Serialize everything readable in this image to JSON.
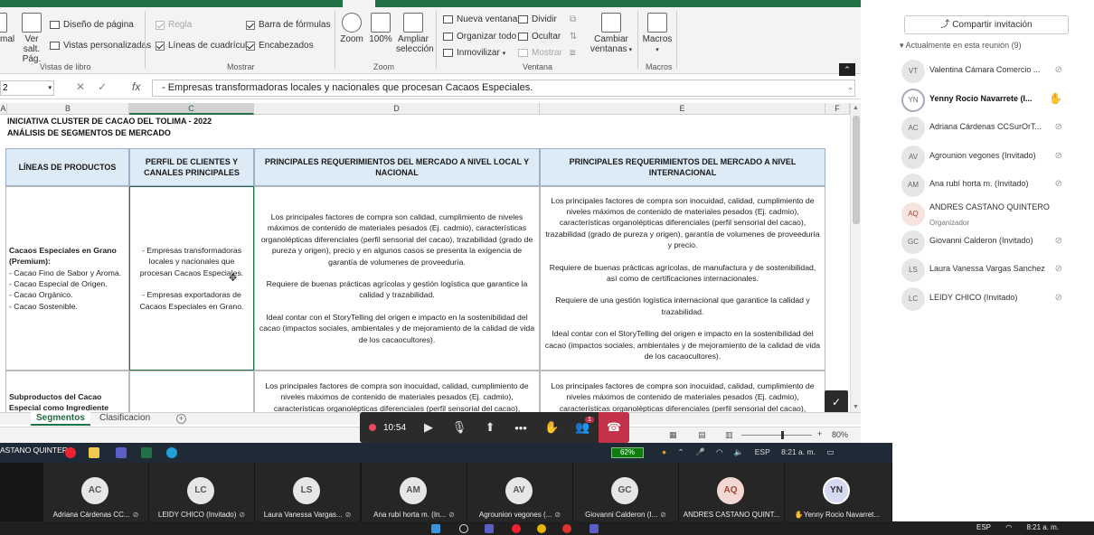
{
  "excel": {
    "ribbon": {
      "ver_salt_line1": "Ver salt.",
      "ver_salt_line2": "Pág.",
      "normal_partial": "mal",
      "diseno_pagina": "Diseño de página",
      "vistas_personalizadas": "Vistas personalizadas",
      "group_vistas": "Vistas de libro",
      "regla": "Regla",
      "barra_formulas": "Barra de fórmulas",
      "lineas_cuadricula": "Líneas de cuadrícula",
      "encabezados": "Encabezados",
      "group_mostrar": "Mostrar",
      "zoom": "Zoom",
      "zoom_100": "100%",
      "ampliar_line1": "Ampliar",
      "ampliar_line2": "selección",
      "group_zoom": "Zoom",
      "nueva_ventana": "Nueva ventana",
      "organizar_todo": "Organizar todo",
      "inmovilizar": "Inmovilizar",
      "dividir": "Dividir",
      "ocultar": "Ocultar",
      "mostrar": "Mostrar",
      "cambiar_line1": "Cambiar",
      "cambiar_line2": "ventanas",
      "group_ventana": "Ventana",
      "macros": "Macros",
      "group_macros": "Macros"
    },
    "formula_bar": {
      "content": "- Empresas transformadoras locales y nacionales que procesan Cacaos Especiales."
    },
    "columns": {
      "a": "A",
      "b": "B",
      "c": "C",
      "d": "D",
      "e": "E",
      "f": "F"
    },
    "sheet": {
      "title1": "INICIATIVA CLUSTER DE CACAO DEL TOLIMA - 2022",
      "title2": "ANÁLISIS DE SEGMENTOS DE MERCADO",
      "headers": {
        "lineas": "LÍNEAS DE PRODUCTOS",
        "perfil": "PERFIL DE CLIENTES Y CANALES PRINCIPALES",
        "local": "PRINCIPALES REQUERIMIENTOS DEL MERCADO A NIVEL LOCAL Y NACIONAL",
        "internacional": "PRINCIPALES REQUERIMIENTOS DEL MERCADO A NIVEL INTERNACIONAL"
      },
      "row1": {
        "b_title": "Cacaos Especiales en Grano (Premium):",
        "b_list": "- Cacao Fino de Sabor y Aroma.\n- Cacao Especial de Origen.\n- Cacao Orgánico.\n- Cacao Sostenible.",
        "c1": "- Empresas transformadoras locales y nacionales que procesan Cacaos Especiales.",
        "c2": "- Empresas exportadoras de Cacaos Especiales en Grano.",
        "d1": "Los principales factores de compra son calidad, cumplimiento de niveles máximos de contenido de materiales pesados (Ej. cadmio), características organolépticas diferenciales (perfil sensorial del cacao), trazabilidad (grado de pureza y origen), precio y en algunos casos se presenta la exigencia de garantía de volumenes de proveeduría.",
        "d2": "Requiere de buenas prácticas agrícolas y gestión logística que garantice la calidad y trazabilidad.",
        "d3": "Ideal contar con el StoryTelling del origen e impacto en la sostenibilidad del cacao (impactos sociales, ambientales y de mejoramiento de la calidad de vida de los cacaocultores).",
        "e1": "Los principales factores de compra son inocuidad, calidad, cumplimiento de niveles máximos de contenido de materiales pesados (Ej. cadmio), características organolépticas diferenciales (perfil sensorial del cacao), trazabilidad (grado de pureza y origen), garantía de volumenes de proveeduría y precio.",
        "e2": "Requiere de buenas prácticas agrícolas, de manufactura y de sostenibilidad, así como de certificaciones internacionales.",
        "e3": "Requiere de una gestión logística internacional que garantice la calidad y trazabilidad.",
        "e4": "Ideal contar con el StoryTelling del origen e impacto en la sostenibilidad del cacao (impactos sociales, ambientales y de mejoramiento de la calidad de vida de los cacaocultores)."
      },
      "row2": {
        "b": "Subproductos del Cacao Especial como Ingrediente Natural para",
        "d": "Los principales factores de compra son inocuidad, calidad, cumplimiento de niveles máximos de contenido de materiales pesados (Ej. cadmio), características organolépticas diferenciales (perfil sensorial del cacao), trazabilidad (grado de",
        "e": "Los principales factores de compra son inocuidad, calidad, cumplimiento de niveles máximos de contenido de materiales pesados (Ej. cadmio), características organolépticas diferenciales (perfil sensorial del cacao), trazabilidad (grado de"
      }
    },
    "sheet_tabs": [
      "Segmentos",
      "Clasificacion"
    ],
    "status": {
      "zoom": "80%"
    }
  },
  "call": {
    "time": "10:54",
    "reactions_badge": "1"
  },
  "panel": {
    "invite": "Compartir invitación",
    "in_meeting": "Actualmente en esta reunión (9)",
    "participants": [
      {
        "initials": "VT",
        "name": "Valentina Cámara Comercio ..."
      },
      {
        "initials": "YN",
        "name": "Yenny Rocio Navarrete (I..."
      },
      {
        "initials": "AC",
        "name": "Adriana Cárdenas CCSurOrT..."
      },
      {
        "initials": "AV",
        "name": "Agrounion vegones (Invitado)"
      },
      {
        "initials": "AM",
        "name": "Ana rubí horta m. (Invitado)"
      },
      {
        "initials": "AQ",
        "name": "ANDRES CASTANO QUINTERO",
        "role": "Organizador"
      },
      {
        "initials": "GC",
        "name": "Giovanni Calderon (Invitado)"
      },
      {
        "initials": "LS",
        "name": "Laura Vanessa Vargas Sanchez"
      },
      {
        "initials": "LC",
        "name": "LEIDY CHICO (Invitado)"
      }
    ]
  },
  "remote_taskbar": {
    "presenter": "ASTANO QUINTERO",
    "battery": "62%",
    "lang": "ESP",
    "time": "8:21 a. m."
  },
  "gallery": [
    {
      "initials": "AC",
      "name": "Adriana Cárdenas CC..."
    },
    {
      "initials": "LC",
      "name": "LEIDY CHICO (Invitado)"
    },
    {
      "initials": "LS",
      "name": "Laura Vanessa Vargas..."
    },
    {
      "initials": "AM",
      "name": "Ana rubí horta m. (In..."
    },
    {
      "initials": "AV",
      "name": "Agrounion vegones (..."
    },
    {
      "initials": "GC",
      "name": "Giovanni Calderon (I..."
    },
    {
      "initials": "AQ",
      "name": "ANDRES CASTANO QUINT..."
    },
    {
      "initials": "YN",
      "name": "Yenny Rocio Navarret..."
    }
  ],
  "local_taskbar": {
    "lang": "ESP",
    "time": "8:21 a. m."
  }
}
